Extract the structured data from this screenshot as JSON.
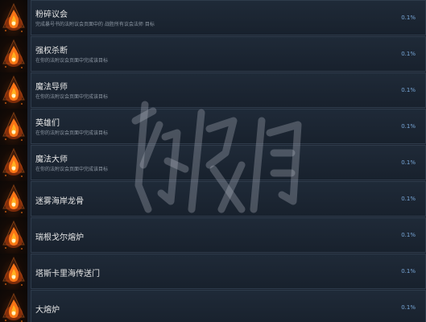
{
  "achievements": [
    {
      "title": "粉碎议会",
      "description": "完成暴号书的法附议会页面中的 战胜所有议会法师 目标",
      "percent": "0.1%",
      "icon": "fire-crystal-icon"
    },
    {
      "title": "强权杀断",
      "description": "在你的法附议会页面中完成该目标",
      "percent": "0.1%",
      "icon": "fire-crystal-icon"
    },
    {
      "title": "魔法导师",
      "description": "在你的法附议会页面中完成该目标",
      "percent": "0.1%",
      "icon": "fire-crystal-icon"
    },
    {
      "title": "英雄们",
      "description": "在你的法附议会页面中完成该目标",
      "percent": "0.1%",
      "icon": "fire-crystal-icon"
    },
    {
      "title": "魔法大师",
      "description": "在你的法附议会页面中完成该目标",
      "percent": "0.1%",
      "icon": "fire-crystal-icon"
    },
    {
      "title": "迷雾海岸龙骨",
      "description": "",
      "percent": "0.1%",
      "icon": "fire-crystal-icon"
    },
    {
      "title": "瑞根戈尔熔炉",
      "description": "",
      "percent": "0.1%",
      "icon": "fire-crystal-icon"
    },
    {
      "title": "塔斯卡里海传送门",
      "description": "",
      "percent": "0.1%",
      "icon": "fire-crystal-icon"
    },
    {
      "title": "大熔炉",
      "description": "",
      "percent": "0.1%",
      "icon": "fire-crystal-icon"
    }
  ],
  "colors": {
    "background": "#1b2330",
    "card_border": "#2e3b4b",
    "title": "#e6e6e6",
    "description": "#8d97a3",
    "percent": "#78a7d8",
    "fire_core": "#ffb020"
  }
}
